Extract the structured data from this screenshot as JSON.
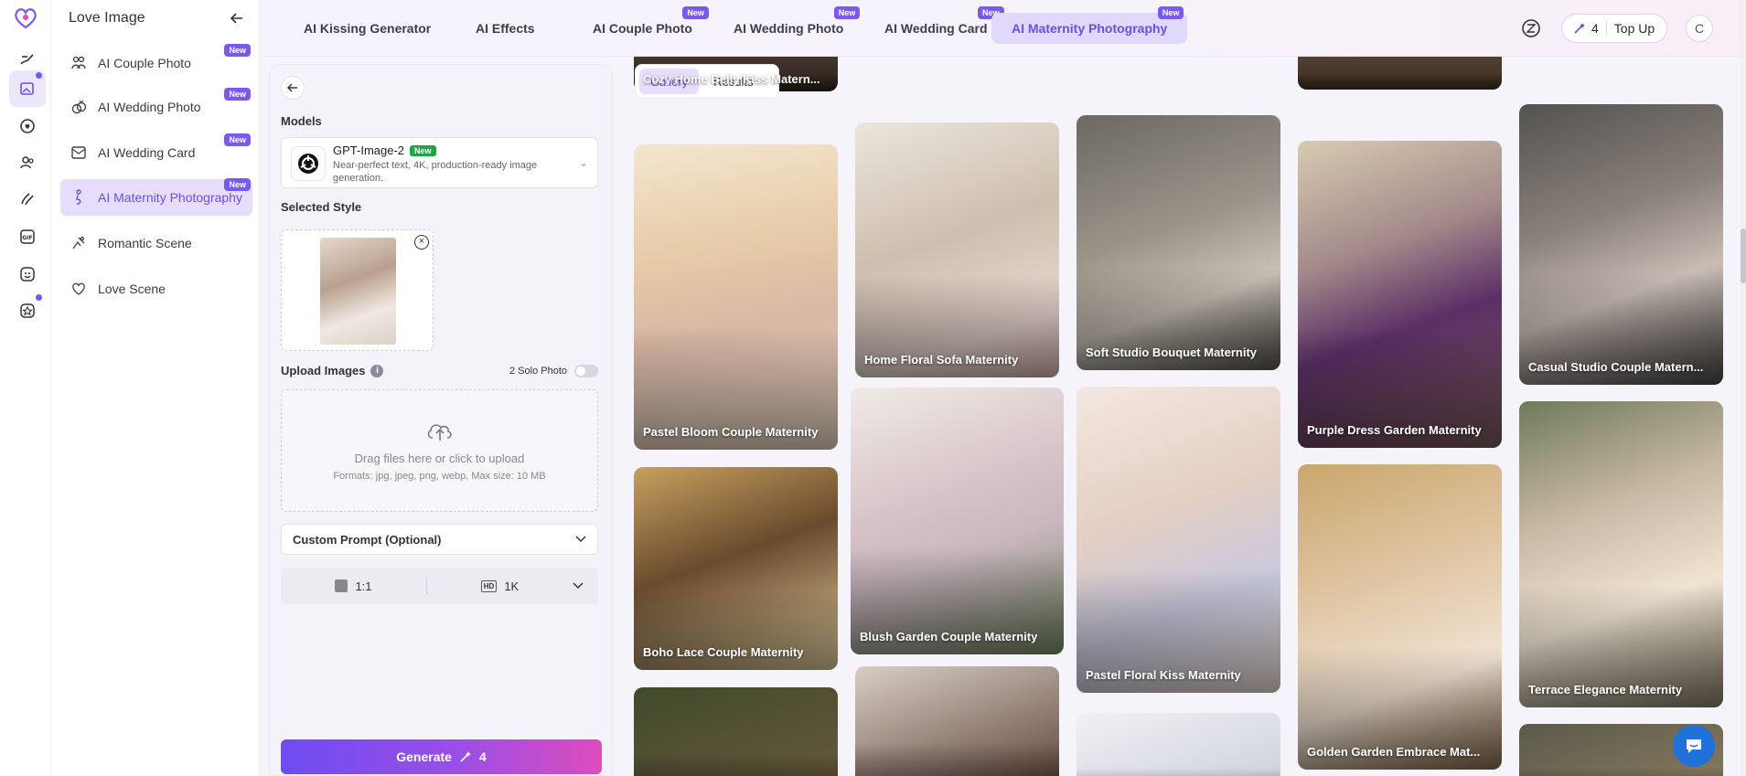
{
  "app": {
    "title": "Love Image"
  },
  "rail": {
    "items": [
      "logo-icon",
      "paint-icon",
      "image-edit-icon",
      "chat-heart-icon",
      "people-icon",
      "kiss-icon",
      "gif-icon",
      "face-icon",
      "badge-icon"
    ]
  },
  "sidebar": {
    "items": [
      {
        "label": "AI Couple Photo",
        "badge": "New"
      },
      {
        "label": "AI Wedding Photo",
        "badge": "New"
      },
      {
        "label": "AI Wedding Card",
        "badge": "New"
      },
      {
        "label": "AI Maternity Photography",
        "badge": "New"
      },
      {
        "label": "Romantic Scene",
        "badge": ""
      },
      {
        "label": "Love Scene",
        "badge": ""
      }
    ]
  },
  "tabs": [
    {
      "label": "AI Kissing Generator",
      "badge": ""
    },
    {
      "label": "AI Effects",
      "badge": ""
    },
    {
      "label": "AI Couple Photo",
      "badge": "New"
    },
    {
      "label": "AI Wedding Photo",
      "badge": "New"
    },
    {
      "label": "AI Wedding Card",
      "badge": "New"
    },
    {
      "label": "AI Maternity Photography",
      "badge": "New"
    }
  ],
  "header": {
    "credits": "4",
    "topup_label": "Top Up",
    "avatar_initial": "C"
  },
  "generator": {
    "models_label": "Models",
    "model": {
      "name": "GPT-Image-2",
      "badge": "New",
      "description": "Near-perfect text, 4K, production-ready image generation."
    },
    "selected_style_label": "Selected Style",
    "upload_label": "Upload Images",
    "solo_label": "2 Solo Photo",
    "solo_enabled": false,
    "drop_main": "Drag files here or click to upload",
    "drop_sub": "Formats: jpg, jpeg, png, webp, Max size: 10 MB",
    "custom_prompt_label": "Custom Prompt (Optional)",
    "ratio": "1:1",
    "resolution": "1K",
    "generate_label": "Generate",
    "generate_cost": "4"
  },
  "gallery": {
    "tabs": [
      "Gallery",
      "Results"
    ],
    "cards": [
      "Pastel Bloom Couple Maternity",
      "Boho Lace Couple Maternity",
      "Home Floral Sofa Maternity",
      "Blush Garden Couple Maternity",
      "Soft Studio Bouquet Maternity",
      "Pastel Floral Kiss Maternity",
      "Purple Dress Garden Maternity",
      "Golden Garden Embrace Mat...",
      "Casual Studio Couple Matern...",
      "Terrace Elegance Maternity",
      "Cozy Home Belly Kiss Matern..."
    ]
  },
  "colors": {
    "accent": "#6a4fe5",
    "badge": "#7a59f0",
    "model_badge": "#21a345"
  }
}
